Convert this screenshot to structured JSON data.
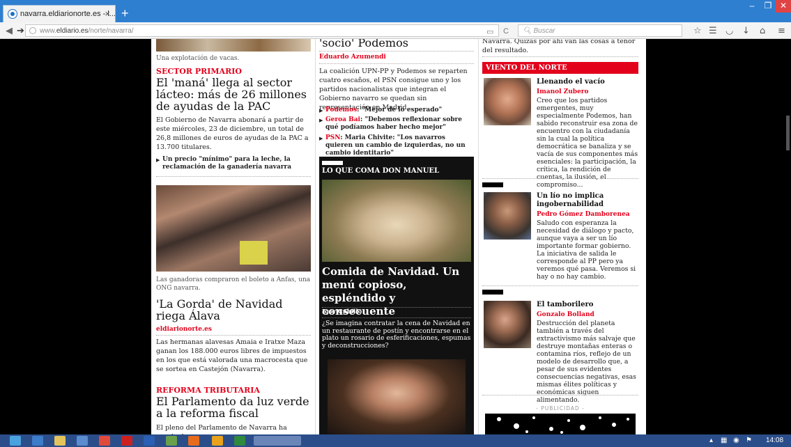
{
  "browser": {
    "tab_title": "navarra.eldiarionorte.es - l...",
    "url_prefix": "www.",
    "url_domain": "eldiario.es",
    "url_path": "/norte/navarra/",
    "search_placeholder": "Buscar",
    "new_tab": "+",
    "close_tab": "×"
  },
  "window": {
    "minimize": "–",
    "maximize": "❐",
    "close": "✕"
  },
  "col1": {
    "caption_top": "Una explotación de vacas.",
    "section1": "SECTOR PRIMARIO",
    "headline1": "El 'maná' llega al sector lácteo: más de 26 millones de ayudas de la PAC",
    "body1": "El Gobierno de Navarra abonará a partir de este miércoles, 23 de diciembre, un total de 26,8 millones de euros de ayudas de la PAC a 13.700 titulares.",
    "related1": "Un precio \"mínimo\" para la leche, la reclamación de la ganadería navarra",
    "caption2": "Las ganadoras compraron el boleto a Anfas, una ONG navarra.",
    "headline2": "'La Gorda' de Navidad riega Álava",
    "source2": "eldiarionorte.es",
    "body2": "Las hermanas alavesas Amaia e Iratxe Maza ganan los 188.000 euros libres de impuestos en los que está valorada una macrocesta que se sortea en Castejón (Navarra).",
    "section3": "REFORMA TRIBUTARIA",
    "headline3": "El Parlamento da luz verde a la reforma fiscal",
    "body3": "El pleno del Parlamento de Navarra ha aprobado"
  },
  "col2": {
    "headline_top": "'socio' Podemos",
    "author1": "Eduardo Azumendi",
    "body1": "La coalición UPN-PP y Podemos se reparten cuatro escaños, el PSN consigue uno y los partidos nacionalistas que integran el Gobierno navarro se quedan sin representación en Madrid",
    "rel1_red": "Podemos",
    "rel1": ": \"Mejor de lo esperado\"",
    "rel2_red": "Geroa Bai",
    "rel2": ": \"Debemos reflexionar sobre qué podíamos haber hecho mejor\"",
    "rel3_red": "PSN",
    "rel3": ": Maria Chivite: \"Los navarros quieren un cambio de izquierdas, no un cambio identitario\"",
    "feature_section": "LO QUE COMA DON MANUEL",
    "feature_headline": "Comida de Navidad. Un menú copioso, espléndido y consecuente",
    "feature_author": "Igor Cubillo",
    "feature_body": "¿Se imagina contratar la cena de Navidad en un restaurante de postín y encontrarse en el plato un rosario de esferificaciones, espumas y deconstrucciones?"
  },
  "col3": {
    "body_top": "Navarra. Quizás por ahí van las cosas a tenor del resultado.",
    "section": "VIENTO DEL NORTE",
    "op1_title": "Llenando el vacío",
    "op1_author": "Imanol Zubero",
    "op1_body": "Creo que los partidos emergentes, muy especialmente Podemos, han sabido reconstruir esa zona de encuentro con la ciudadanía sin la cual la política democrática se banaliza y se vacía de sus componentes más esenciales: la participación, la crítica, la rendición de cuentas, la ilusión, el compromiso...",
    "op2_title": "Un lío no implica ingobernabilidad",
    "op2_author": "Pedro Gómez Damborenea",
    "op2_body": "Saludo con esperanza la necesidad de diálogo y pacto, aunque vaya a ser un lío importante formar gobierno. La iniciativa de salida le corresponde al PP pero ya veremos qué pasa. Veremos si hay o no hay cambio.",
    "op3_title": "El tamborilero",
    "op3_author": "Gonzalo Bolland",
    "op3_body": "Destrucción del planeta también a través del extractivismo más salvaje que destruye montañas enteras o contamina ríos, reflejo de un modelo de desarrollo que, a pesar de sus evidentes consecuencias negativas, esas mismas élites políticas y económicas siguen alimentando.",
    "ad_label": "- PUBLICIDAD -"
  },
  "taskbar": {
    "clock": "14:08"
  }
}
